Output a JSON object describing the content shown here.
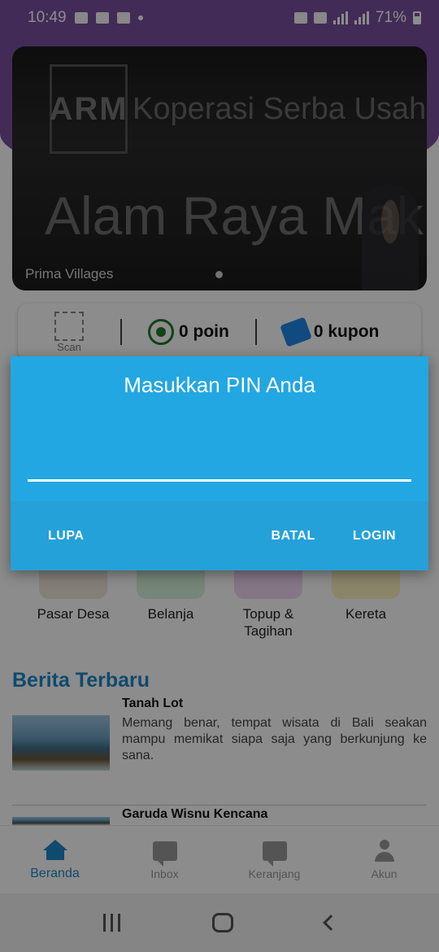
{
  "status_bar": {
    "time": "10:49",
    "battery": "71%"
  },
  "banner": {
    "logo_text": "ARM",
    "subtitle": "Koperasi Serba Usaha",
    "title": "Alam Raya Makmur",
    "caption": "Prima Villages"
  },
  "points_card": {
    "scan_label": "Scan",
    "points": "0 poin",
    "coupons": "0 kupon"
  },
  "menu": [
    {
      "label": "Pasar Desa",
      "color": "#8a6a4a"
    },
    {
      "label": "Belanja",
      "color": "#4caf50"
    },
    {
      "label": "Topup &\nTagihan",
      "color": "#c040c0"
    },
    {
      "label": "Kereta",
      "color": "#f5c400"
    }
  ],
  "news": {
    "section_title": "Berita Terbaru",
    "items": [
      {
        "title": "Tanah Lot",
        "body": "Memang benar, tempat wisata di Bali seakan mampu memikat siapa saja yang berkunjung ke sana."
      },
      {
        "title": "Garuda Wisnu Kencana",
        "body": ""
      }
    ]
  },
  "bottom_nav": [
    {
      "label": "Beranda",
      "icon": "home-icon",
      "active": true
    },
    {
      "label": "Inbox",
      "icon": "message-icon",
      "active": false
    },
    {
      "label": "Keranjang",
      "icon": "message-icon",
      "active": false
    },
    {
      "label": "Akun",
      "icon": "user-icon",
      "active": false
    }
  ],
  "dialog": {
    "title": "Masukkan PIN Anda",
    "pin_value": "",
    "forgot_label": "LUPA",
    "cancel_label": "BATAL",
    "login_label": "LOGIN",
    "bg_color": "#22a7e2"
  }
}
